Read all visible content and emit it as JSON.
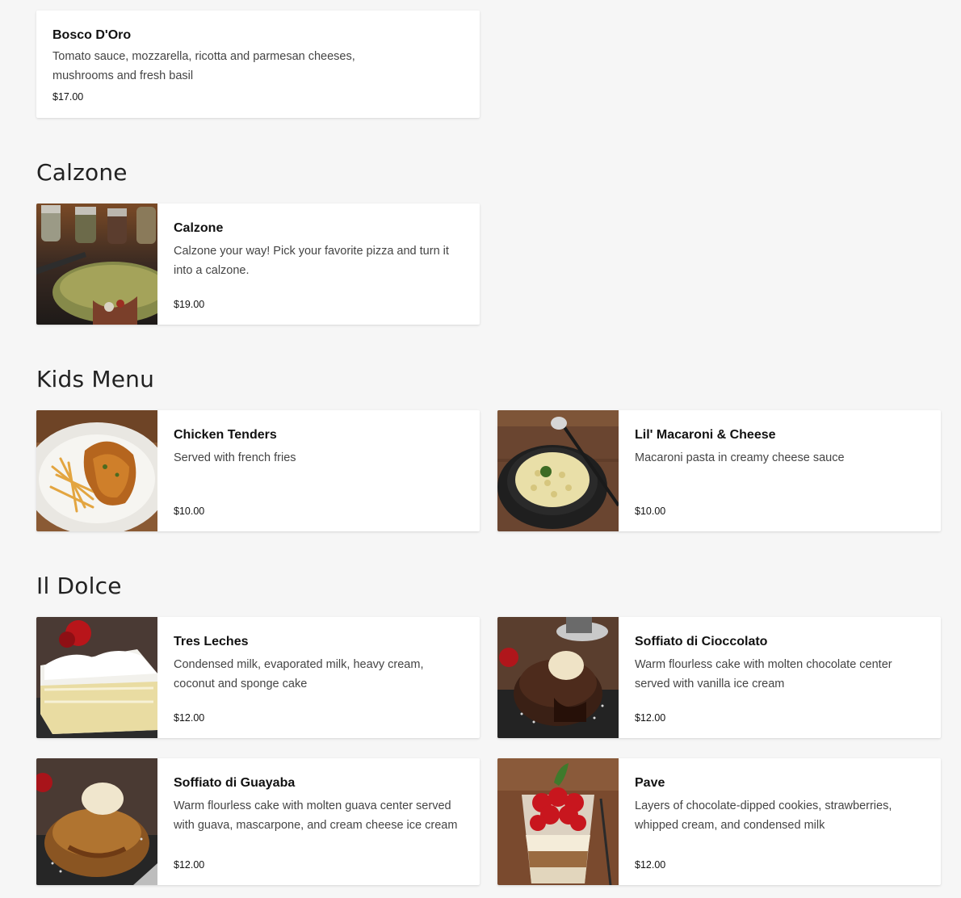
{
  "sections": [
    {
      "title": "",
      "items": [
        {
          "name": "Bosco D'Oro",
          "description": "Tomato sauce, mozzarella, ricotta and parmesan cheeses, mushrooms and fresh basil",
          "price": "$17.00"
        }
      ]
    },
    {
      "title": "Calzone",
      "items": [
        {
          "name": "Calzone",
          "description": "Calzone your way! Pick your favorite pizza and turn it into a calzone.",
          "price": "$19.00",
          "image": "calzone-photo"
        }
      ]
    },
    {
      "title": "Kids Menu",
      "items": [
        {
          "name": "Chicken Tenders",
          "description": "Served with french fries",
          "price": "$10.00",
          "image": "chicken-tenders-photo"
        },
        {
          "name": "Lil' Macaroni & Cheese",
          "description": "Macaroni pasta in creamy cheese sauce",
          "price": "$10.00",
          "image": "mac-and-cheese-photo"
        }
      ]
    },
    {
      "title": "Il Dolce",
      "items": [
        {
          "name": "Tres Leches",
          "description": "Condensed milk, evaporated milk, heavy cream, coconut and sponge cake",
          "price": "$12.00",
          "image": "tres-leches-photo"
        },
        {
          "name": "Soffiato di Cioccolato",
          "description": "Warm flourless cake with molten chocolate center served with vanilla ice cream",
          "price": "$12.00",
          "image": "chocolate-cake-photo"
        },
        {
          "name": "Soffiato di Guayaba",
          "description": "Warm flourless cake with molten guava center served with guava, mascarpone, and cream cheese ice cream",
          "price": "$12.00",
          "image": "guava-cake-photo"
        },
        {
          "name": "Pave",
          "description": "Layers of chocolate-dipped cookies, strawberries, whipped cream, and condensed milk",
          "price": "$12.00",
          "image": "pave-photo"
        }
      ]
    }
  ]
}
